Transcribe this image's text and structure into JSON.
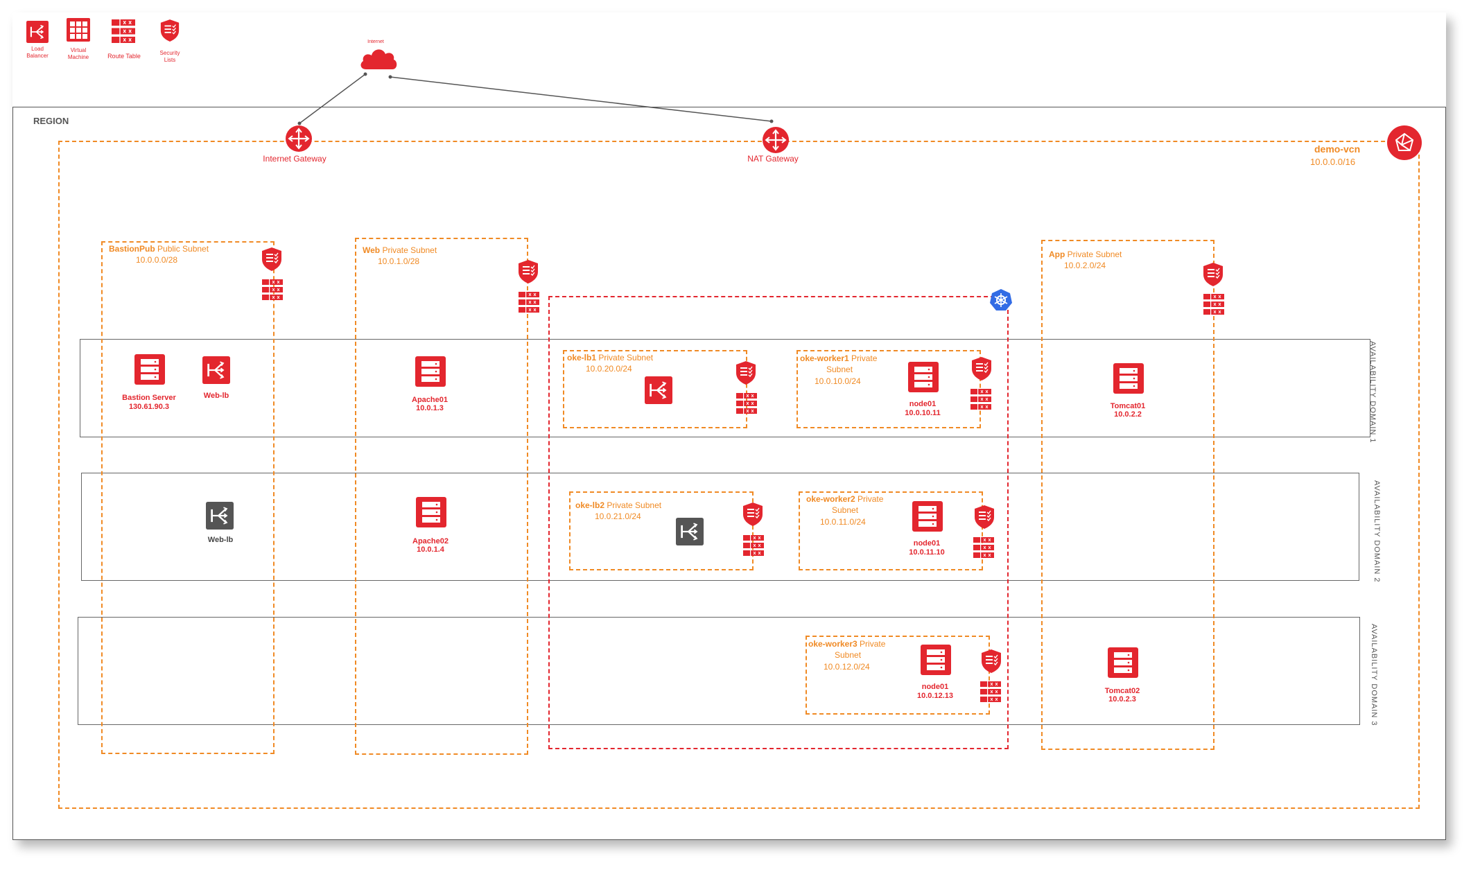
{
  "legend": {
    "load_balancer": "Load\nBalancer",
    "virtual_machine": "Virtual\nMachine",
    "route_table": "Route Table",
    "security_lists": "Security\nLists"
  },
  "internet": {
    "label": "Internet"
  },
  "region": {
    "label": "REGION"
  },
  "vcn": {
    "name": "demo-vcn",
    "cidr": "10.0.0.0/16"
  },
  "gateways": {
    "internet": "Internet Gateway",
    "nat": "NAT Gateway"
  },
  "subnets": {
    "bastion": {
      "name": "BastionPub",
      "type": "Public Subnet",
      "cidr": "10.0.0.0/28"
    },
    "web": {
      "name": "Web",
      "type": "Private Subnet",
      "cidr": "10.0.1.0/28"
    },
    "app": {
      "name": "App",
      "type": "Private Subnet",
      "cidr": "10.0.2.0/24"
    },
    "oke_lb1": {
      "name": "oke-lb1",
      "type": "Private Subnet",
      "cidr": "10.0.20.0/24"
    },
    "oke_lb2": {
      "name": "oke-lb2",
      "type": "Private Subnet",
      "cidr": "10.0.21.0/24"
    },
    "oke_worker1": {
      "name": "oke-worker1",
      "type": "Private",
      "type2": "Subnet",
      "cidr": "10.0.10.0/24"
    },
    "oke_worker2": {
      "name": "oke-worker2",
      "type": "Private",
      "type2": "Subnet",
      "cidr": "10.0.11.0/24"
    },
    "oke_worker3": {
      "name": "oke-worker3",
      "type": "Private",
      "type2": "Subnet",
      "cidr": "10.0.12.0/24"
    }
  },
  "availability_domains": [
    "AVAILABILITY DOMAIN 1",
    "AVAILABILITY DOMAIN 2",
    "AVAILABILITY DOMAIN 3"
  ],
  "nodes": {
    "bastion_server": {
      "name": "Bastion Server",
      "ip": "130.61.90.3"
    },
    "web_lb_1": {
      "name": "Web-lb"
    },
    "web_lb_2": {
      "name": "Web-lb"
    },
    "apache01": {
      "name": "Apache01",
      "ip": "10.0.1.3"
    },
    "apache02": {
      "name": "Apache02",
      "ip": "10.0.1.4"
    },
    "tomcat01": {
      "name": "Tomcat01",
      "ip": "10.0.2.2"
    },
    "tomcat02": {
      "name": "Tomcat02",
      "ip": "10.0.2.3"
    },
    "node_ad1": {
      "name": "node01",
      "ip": "10.0.10.11"
    },
    "node_ad2": {
      "name": "node01",
      "ip": "10.0.11.10"
    },
    "node_ad3": {
      "name": "node01",
      "ip": "10.0.12.13"
    }
  },
  "colors": {
    "red": "#e3262e",
    "orange": "#f08a24",
    "blue": "#326ce5",
    "gray": "#555555"
  }
}
